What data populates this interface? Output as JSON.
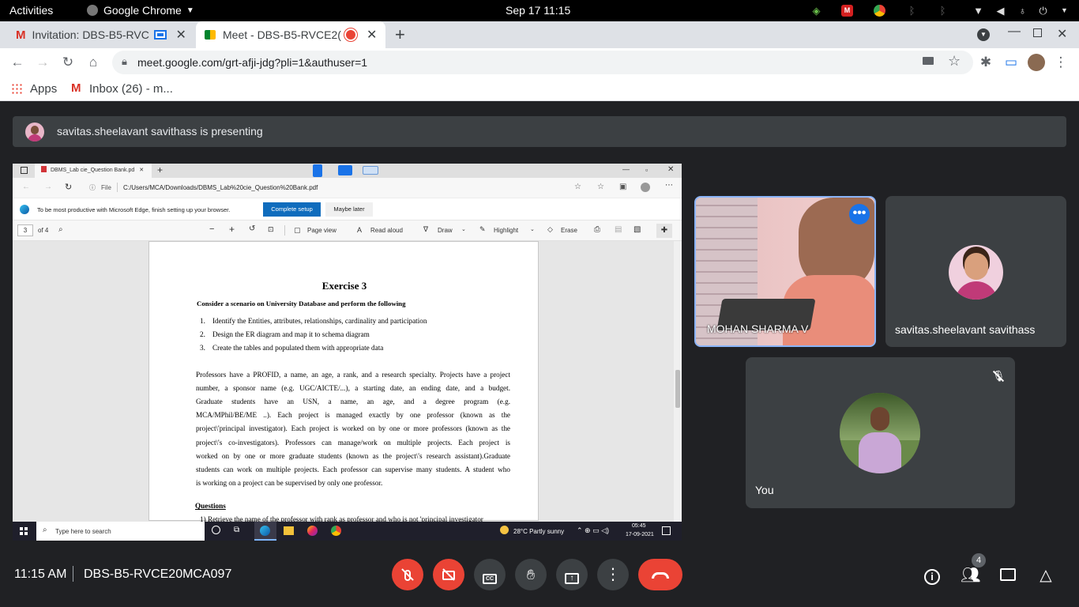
{
  "os": {
    "activities": "Activities",
    "app_name": "Google Chrome",
    "clock": "Sep 17  11:15"
  },
  "chrome": {
    "tabs": [
      {
        "label": "Invitation: DBS-B5-RVC"
      },
      {
        "label": "Meet - DBS-B5-RVCE2("
      }
    ],
    "url": "meet.google.com/grt-afji-jdg?pli=1&authuser=1",
    "bookmarks": [
      {
        "label": "Apps"
      },
      {
        "label": "Inbox (26) - m..."
      }
    ]
  },
  "meet": {
    "presenting_text": "savitas.sheelavant savithass is presenting",
    "participants": [
      {
        "name": "MOHAN SHARMA V"
      },
      {
        "name": "savitas.sheelavant savithass"
      },
      {
        "name": "You"
      }
    ],
    "footer_time": "11:15 AM",
    "meeting_code": "DBS-B5-RVCE20MCA097",
    "participant_count": "4"
  },
  "shared": {
    "tab_title": "DBMS_Lab cie_Question Bank.pd",
    "file_label": "File",
    "file_path": "C:/Users/MCA/Downloads/DBMS_Lab%20cie_Question%20Bank.pdf",
    "edge_banner": "To be most productive with Microsoft Edge, finish setting up your browser.",
    "complete_setup": "Complete setup",
    "maybe_later": "Maybe later",
    "page_num": "3",
    "page_of": "of 4",
    "pdf_tools": {
      "page_view": "Page view",
      "read_aloud": "Read aloud",
      "draw": "Draw",
      "highlight": "Highlight",
      "erase": "Erase"
    },
    "doc": {
      "title": "Exercise 3",
      "intro": "Consider a scenario on University  Database  and perform the following",
      "tasks": [
        "Identify the Entities, attributes, relationships, cardinality and participation",
        "Design the ER diagram and map it to schema diagram",
        "Create the tables and populated them with appropriate data"
      ],
      "para_lines": [
        "Professors have a PROFID, a name, an age, a rank, and a research specialty. Projects have a project",
        "number, a sponsor name (e.g. UGC/AICTE/...), a starting date, an ending date, and a budget.",
        "Graduate students have an USN, a name, an age, and a degree program (e.g.",
        "MCA/MPhil/BE/ME ..). Each project is managed exactly by one professor (known as the",
        "project\\'principal investigator). Each project is worked on by one or more professors (known as the",
        "project\\'s co-investigators). Professors can manage/work on multiple projects. Each project is",
        "worked on by one or more graduate students (known as the project\\'s research assistant).Graduate",
        "students can work on multiple projects. Each professor can supervise many students. A student who",
        "is working on a project can be supervised by only one professor."
      ],
      "questions_heading": "Questions",
      "q1_partial": "1)   Retrieve the name of the professor with rank as professor and who is not 'principal investigator"
    },
    "taskbar": {
      "search": "Type here to search",
      "weather": "28°C  Partly sunny",
      "time": "05:45",
      "date": "17-09-2021"
    }
  }
}
